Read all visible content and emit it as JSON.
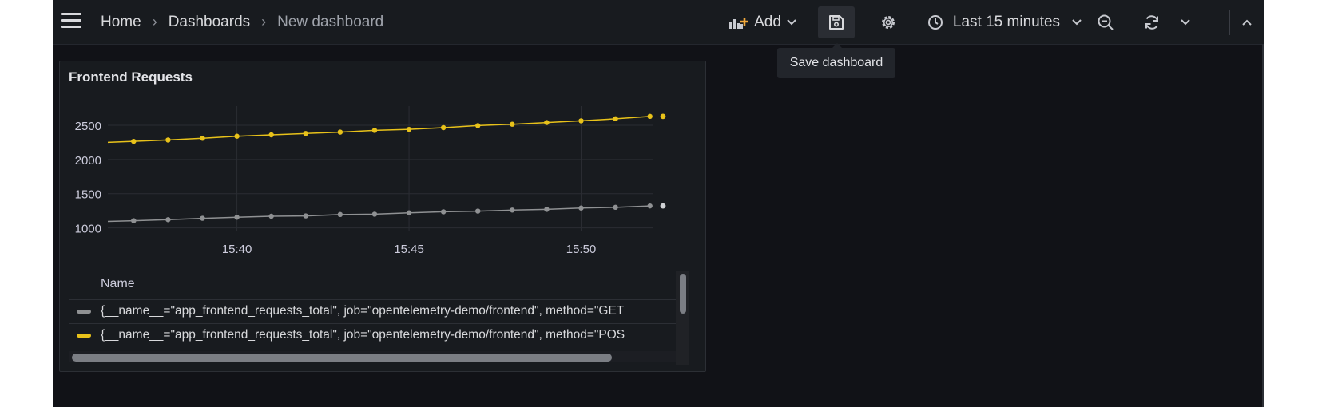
{
  "breadcrumb": {
    "home": "Home",
    "dashboards": "Dashboards",
    "current": "New dashboard"
  },
  "toolbar": {
    "add_label": "Add",
    "time_range": "Last 15 minutes",
    "save_tooltip": "Save dashboard"
  },
  "icons": {
    "menu": "hamburger-icon",
    "add": "add-panel-icon",
    "save": "save-icon",
    "settings": "gear-icon",
    "time": "clock-icon",
    "zoom_out": "zoom-out-icon",
    "refresh": "refresh-icon",
    "collapse": "chevron-up-icon"
  },
  "panel": {
    "title": "Frontend Requests",
    "legend_header": "Name"
  },
  "colors": {
    "series_post": "#e8c21a",
    "series_get": "#8f9193",
    "background": "#111217",
    "panel": "#181b1f"
  },
  "chart_data": {
    "type": "line",
    "title": "Frontend Requests",
    "x_ticks": [
      "15:40",
      "15:45",
      "15:50"
    ],
    "x": [
      "15:37",
      "15:38",
      "15:39",
      "15:40",
      "15:41",
      "15:42",
      "15:43",
      "15:44",
      "15:45",
      "15:46",
      "15:47",
      "15:48",
      "15:49",
      "15:50",
      "15:51",
      "15:52"
    ],
    "y_ticks": [
      1000,
      1500,
      2000,
      2500
    ],
    "ylim": [
      960,
      2780
    ],
    "grid": true,
    "legend_placement": "bottom",
    "series": [
      {
        "name": "{__name__=\"app_frontend_requests_total\", job=\"opentelemetry-demo/frontend\", method=\"GET\"}",
        "legend_text": "{__name__=\"app_frontend_requests_total\", job=\"opentelemetry-demo/frontend\", method=\"GET",
        "color": "#8f9193",
        "values": [
          1105,
          1120,
          1140,
          1155,
          1170,
          1175,
          1195,
          1200,
          1220,
          1235,
          1245,
          1260,
          1270,
          1290,
          1300,
          1320
        ]
      },
      {
        "name": "{__name__=\"app_frontend_requests_total\", job=\"opentelemetry-demo/frontend\", method=\"POST\"}",
        "legend_text": "{__name__=\"app_frontend_requests_total\", job=\"opentelemetry-demo/frontend\", method=\"POS",
        "color": "#e8c21a",
        "values": [
          2265,
          2285,
          2310,
          2340,
          2360,
          2380,
          2400,
          2425,
          2440,
          2465,
          2495,
          2515,
          2540,
          2565,
          2595,
          2630
        ]
      }
    ]
  }
}
